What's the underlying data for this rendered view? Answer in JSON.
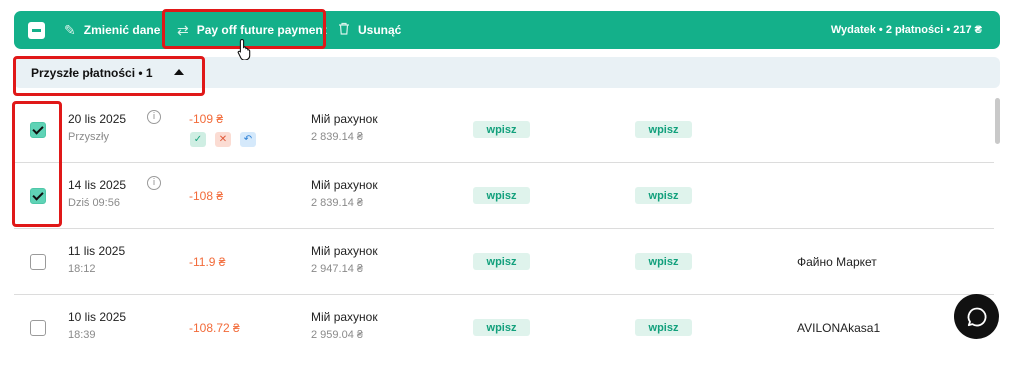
{
  "toolbar": {
    "edit_label": "Zmienić dane",
    "payoff_label": "Pay off future payment",
    "delete_label": "Usunąć",
    "summary": "Wydatek • 2 płatności • 217 ₴"
  },
  "group": {
    "label": "Przyszłe płatności • 1"
  },
  "colors": {
    "accent": "#14b08a",
    "amount": "#f26b3a",
    "highlight": "#e01818"
  },
  "rows": [
    {
      "date": "20 lis 2025",
      "sub": "Przyszły",
      "amount": "-109 ₴",
      "account": "Мій рахунок",
      "balance": "2 839.14 ₴",
      "tag1": "wpisz",
      "tag2": "wpisz",
      "payee": "",
      "checked": true
    },
    {
      "date": "14 lis 2025",
      "sub": "Dziś 09:56",
      "amount": "-108 ₴",
      "account": "Мій рахунок",
      "balance": "2 839.14 ₴",
      "tag1": "wpisz",
      "tag2": "wpisz",
      "payee": "",
      "checked": true
    },
    {
      "date": "11 lis 2025",
      "sub": "18:12",
      "amount": "-11.9 ₴",
      "account": "Мій рахунок",
      "balance": "2 947.14 ₴",
      "tag1": "wpisz",
      "tag2": "wpisz",
      "payee": "Файно Маркет",
      "checked": false
    },
    {
      "date": "10 lis 2025",
      "sub": "18:39",
      "amount": "-108.72 ₴",
      "account": "Мій рахунок",
      "balance": "2 959.04 ₴",
      "tag1": "wpisz",
      "tag2": "wpisz",
      "payee": "AVILONAkasa1",
      "checked": false
    }
  ],
  "icons": {
    "edit": "pencil-icon",
    "payoff": "transfer-arrows-icon",
    "delete": "trash-icon",
    "info": "info-icon",
    "chat": "chat-bubble-icon"
  }
}
